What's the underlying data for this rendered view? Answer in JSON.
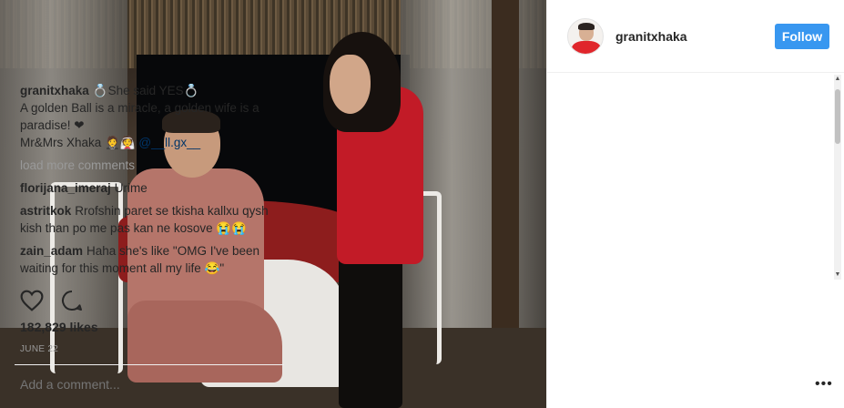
{
  "post": {
    "username": "granitxhaka",
    "follow_label": "Follow",
    "caption": {
      "username": "granitxhaka",
      "line1": "💍She said YES💍",
      "line2": "A golden Ball is a miracle, a golden wife is a paradise! ❤",
      "line3": "Mr&Mrs Xhaka 🤵👰 ",
      "mention": "@__ll.gx__"
    },
    "load_more_label": "load more comments",
    "comments": [
      {
        "username": "florijana_imeraj",
        "text": "Urime"
      },
      {
        "username": "astritkok",
        "text": "Rrofshin paret se tkisha kallxu qysh kish than po me pas kan ne kosove 😭😭"
      },
      {
        "username": "zain_adam",
        "text": "Haha she's like \"OMG I've been waiting for this moment all my life 😂\""
      }
    ],
    "likes": "182,829 likes",
    "date": "JUNE 22",
    "add_comment_placeholder": "Add a comment...",
    "more_label": "•••"
  },
  "icons": {
    "like": "heart-icon",
    "comment": "comment-bubble-icon",
    "more": "more-options-icon"
  },
  "colors": {
    "follow_button": "#3897f0",
    "mention": "#003569",
    "muted_text": "#999999"
  }
}
